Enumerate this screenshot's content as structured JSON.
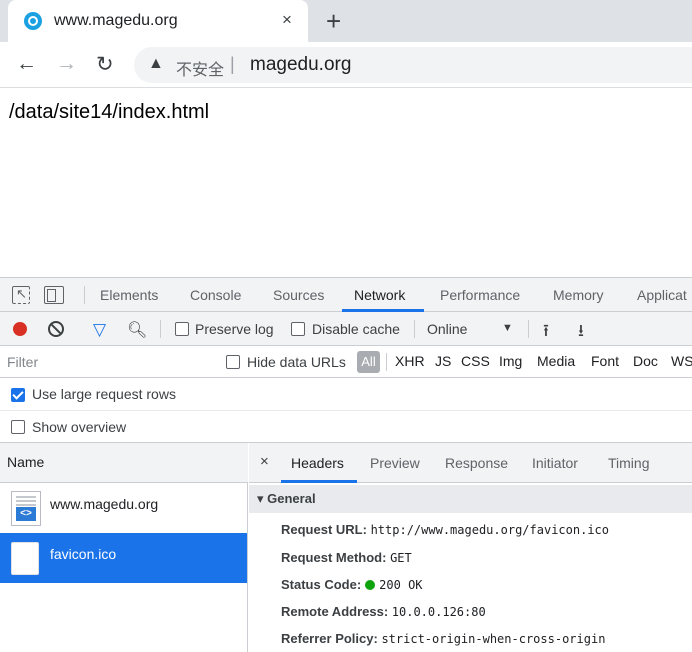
{
  "browser": {
    "tab_title": "www.magedu.org",
    "tab_close": "×",
    "new_tab": "+",
    "insecure_label": "不安全",
    "url_separator": "|",
    "url": "magedu.org"
  },
  "page": {
    "content_text": "/data/site14/index.html"
  },
  "devtools": {
    "tabs": [
      "Elements",
      "Console",
      "Sources",
      "Network",
      "Performance",
      "Memory",
      "Applicat"
    ],
    "active_tab": "Network",
    "toolbar": {
      "preserve_log": "Preserve log",
      "disable_cache": "Disable cache",
      "throttling": "Online"
    },
    "filter_placeholder": "Filter",
    "hide_data_urls": "Hide data URLs",
    "type_filters": [
      "All",
      "XHR",
      "JS",
      "CSS",
      "Img",
      "Media",
      "Font",
      "Doc",
      "WS"
    ],
    "use_large_rows": "Use large request rows",
    "show_overview": "Show overview",
    "name_column": "Name",
    "requests": [
      {
        "name": "www.magedu.org",
        "icon": "html-document-icon"
      },
      {
        "name": "favicon.ico",
        "icon": "blank-file-icon",
        "selected": true
      }
    ],
    "detail_close": "×",
    "detail_tabs": [
      "Headers",
      "Preview",
      "Response",
      "Initiator",
      "Timing"
    ],
    "general_title": "General",
    "general": {
      "request_url_key": "Request URL:",
      "request_url": "http://www.magedu.org/favicon.ico",
      "request_method_key": "Request Method:",
      "request_method": "GET",
      "status_code_key": "Status Code:",
      "status_code": "200 OK",
      "remote_address_key": "Remote Address:",
      "remote_address": "10.0.0.126:80",
      "referrer_policy_key": "Referrer Policy:",
      "referrer_policy": "strict-origin-when-cross-origin"
    }
  },
  "colors": {
    "accent": "#1a73e8",
    "record": "#d93025",
    "status_ok": "#0ca30c"
  }
}
